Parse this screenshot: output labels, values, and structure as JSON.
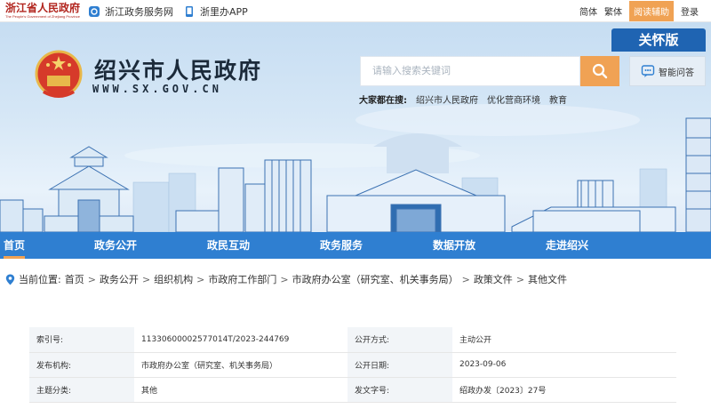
{
  "topbar": {
    "logo_title": "浙江省人民政府",
    "logo_subtitle": "The People's Government of Zhejiang Province",
    "link_service": "浙江政务服务网",
    "link_app": "浙里办APP",
    "simplified": "简体",
    "traditional": "繁体",
    "reading_aid": "阅读辅助",
    "login": "登录"
  },
  "header": {
    "site_title": "绍兴市人民政府",
    "site_domain": "WWW.SX.GOV.CN",
    "care_mode": "关怀版",
    "search_placeholder": "请输入搜索关键词",
    "ask_label": "智能问答",
    "hot_label": "大家都在搜:",
    "hot_terms": [
      "绍兴市人民政府",
      "优化营商环境",
      "教育"
    ]
  },
  "nav": {
    "items": [
      "首页",
      "政务公开",
      "政民互动",
      "政务服务",
      "数据开放",
      "走进绍兴"
    ],
    "active_index": 0
  },
  "breadcrumb": {
    "label": "当前位置:",
    "items": [
      "首页",
      "政务公开",
      "组织机构",
      "市政府工作部门",
      "市政府办公室（研究室、机关事务局）",
      "政策文件",
      "其他文件"
    ]
  },
  "doc_info": {
    "rows": [
      {
        "k1": "索引号:",
        "v1": "11330600002577014T/2023-244769",
        "k2": "公开方式:",
        "v2": "主动公开"
      },
      {
        "k1": "发布机构:",
        "v1": "市政府办公室（研究室、机关事务局）",
        "k2": "公开日期:",
        "v2": "2023-09-06"
      },
      {
        "k1": "主题分类:",
        "v1": "其他",
        "k2": "发文字号:",
        "v2": "绍政办发〔2023〕27号"
      }
    ]
  },
  "colors": {
    "nav_blue": "#2f7fd1",
    "accent_orange": "#f0a254",
    "care_blue": "#1f64b2",
    "brand_red": "#b2261f"
  },
  "icons": [
    "service-icon",
    "phone-icon",
    "national-emblem-icon",
    "search-icon",
    "chat-icon",
    "location-pin-icon"
  ]
}
